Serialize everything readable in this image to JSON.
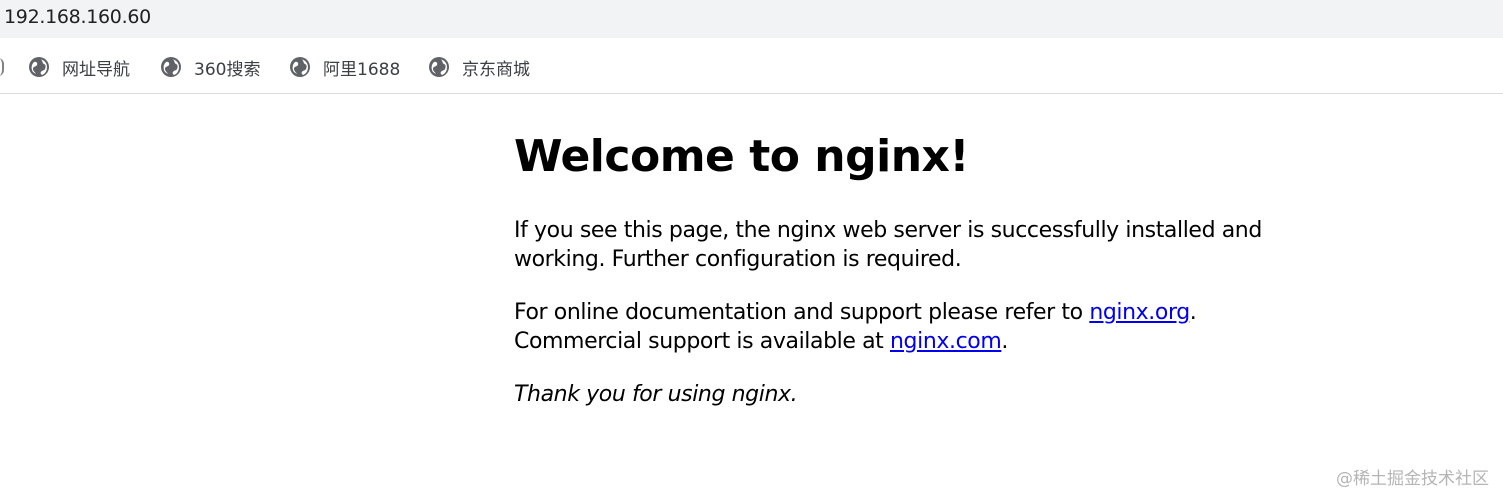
{
  "browser": {
    "address": "192.168.160.60",
    "bookmarks": [
      {
        "label": "网址导航",
        "icon": "globe-icon"
      },
      {
        "label": "360搜索",
        "icon": "globe-icon"
      },
      {
        "label": "阿里1688",
        "icon": "globe-icon"
      },
      {
        "label": "京东商城",
        "icon": "globe-icon"
      }
    ]
  },
  "page": {
    "heading": "Welcome to nginx!",
    "para1": "If you see this page, the nginx web server is successfully installed and working. Further configuration is required.",
    "para2_prefix": "For online documentation and support please refer to ",
    "link_org": "nginx.org",
    "para2_mid": ".",
    "para2_line2": "Commercial support is available at ",
    "link_com": "nginx.com",
    "para2_end": ".",
    "thanks": "Thank you for using nginx."
  },
  "watermark": "@稀土掘金技术社区",
  "colors": {
    "link": "#0000ee",
    "toolbar_bg": "#f1f3f4"
  }
}
